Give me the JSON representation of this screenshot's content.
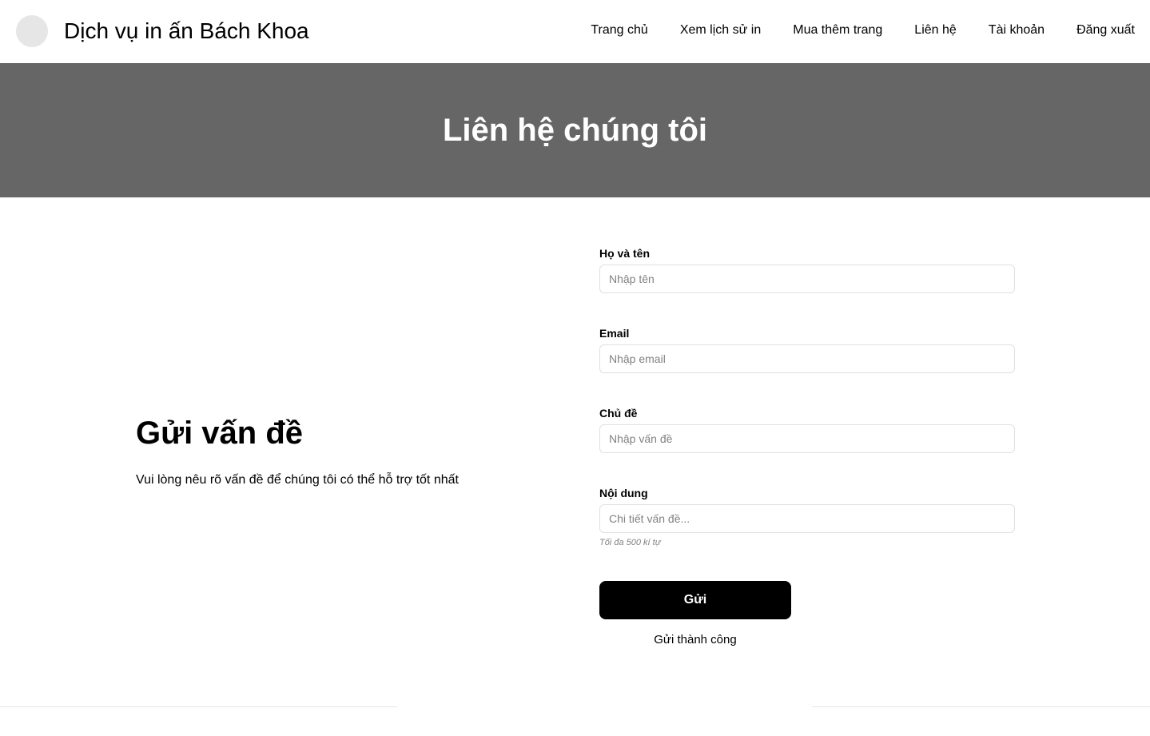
{
  "header": {
    "site_title": "Dịch vụ in ấn Bách Khoa",
    "nav": [
      {
        "label": "Trang chủ"
      },
      {
        "label": "Xem lịch sử in"
      },
      {
        "label": "Mua thêm trang"
      },
      {
        "label": "Liên hệ"
      },
      {
        "label": "Tài khoản"
      },
      {
        "label": "Đăng xuất"
      }
    ]
  },
  "hero": {
    "title": "Liên hệ chúng tôi"
  },
  "intro": {
    "heading": "Gửi vấn đề",
    "description": "Vui lòng nêu rõ vấn đề để chúng tôi có thể hỗ trợ tốt nhất"
  },
  "form": {
    "name": {
      "label": "Họ và tên",
      "placeholder": "Nhập tên",
      "value": ""
    },
    "email": {
      "label": "Email",
      "placeholder": "Nhập email",
      "value": ""
    },
    "subject": {
      "label": "Chủ đề",
      "placeholder": "Nhập vấn đề",
      "value": ""
    },
    "content": {
      "label": "Nội dung",
      "placeholder": "Chi tiết vấn đề...",
      "value": "",
      "hint": "Tối đa 500 kí tự"
    },
    "submit_label": "Gửi",
    "success_message": "Gửi thành công"
  },
  "colors": {
    "hero_bg": "#666666",
    "button_bg": "#000000",
    "logo_bg": "#e6e6e6"
  }
}
